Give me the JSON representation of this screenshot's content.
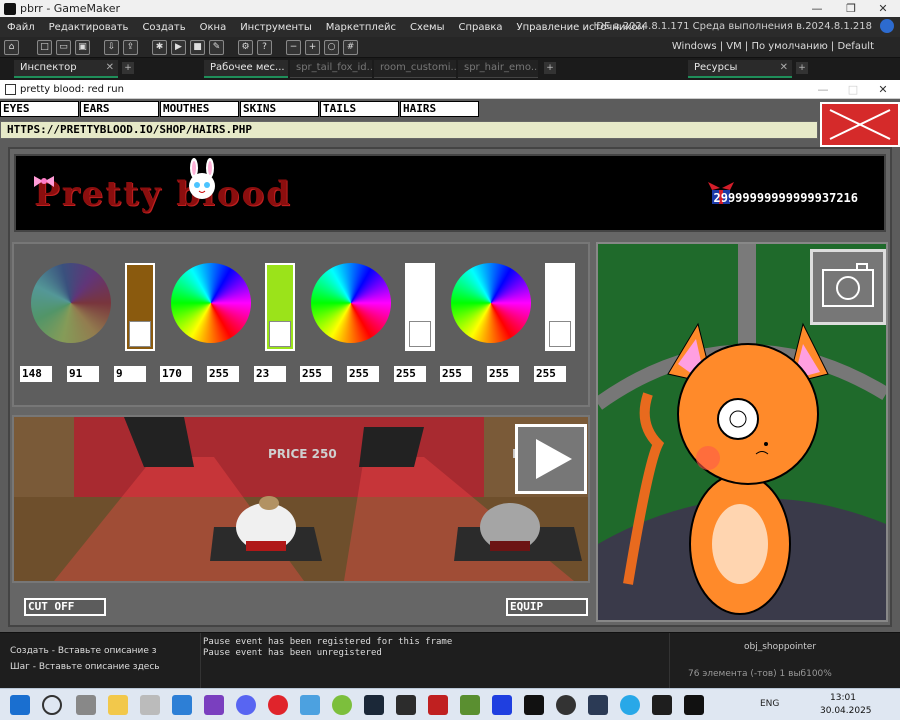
{
  "ide": {
    "title": "pbrr - GameMaker",
    "menu": [
      "Файл",
      "Редактировать",
      "Создать",
      "Окна",
      "Инструменты",
      "Маркетплейс",
      "Схемы",
      "Справка",
      "Управление источником"
    ],
    "version_info": "IDE в.2024.8.1.171  Среда выполнения в.2024.8.1.218",
    "layout_info": "Windows | VM | По умолчанию | Default",
    "tabs": {
      "inspector": "Инспектор",
      "workspace": "Рабочее мес...",
      "spr_tail": "spr_tail_fox_id...",
      "room_custom": "room_customi...",
      "spr_hair": "spr_hair_emo...",
      "resources": "Ресурсы"
    }
  },
  "game_window": {
    "title": "pretty blood: red run",
    "tabs": [
      "EYES",
      "EARS",
      "MOUTHES",
      "SKINS",
      "TAILS",
      "HAIRS"
    ],
    "url": "HTTPS://PRETTYBLOOD.IO/SHOP/HAIRS.PHP",
    "logo_text": "Pretty blood",
    "money": "29999999999999937216",
    "color_values": [
      "148",
      "91",
      "9",
      "170",
      "255",
      "23",
      "255",
      "255",
      "255",
      "255",
      "255",
      "255"
    ],
    "swatches": [
      "#8a5a0e",
      "#9be31a",
      "#ffffff",
      "#ffffff"
    ],
    "price": "PRICE 250",
    "price_partial": "P",
    "buttons": {
      "cut_off": "CUT OFF",
      "equip": "EQUIP"
    }
  },
  "bottom": {
    "events": [
      "Создать - Вставьте описание з",
      "Шаг - Вставьте описание здесь"
    ],
    "log": [
      "Pause event has been registered for this frame",
      "Pause event has been unregistered"
    ],
    "resource_item": "obj_shoppointer",
    "count": "76 элемента (-тов)  1 выб100%"
  },
  "taskbar": {
    "lang": "ENG",
    "time": "13:01",
    "date": "30.04.2025"
  },
  "colors": {
    "game_bg": "#5c5c5c",
    "close_red": "#d52a2a",
    "stage_red": "#8c1c22",
    "preview_green": "#1f6a2b",
    "cat_orange": "#ff8a2a"
  }
}
